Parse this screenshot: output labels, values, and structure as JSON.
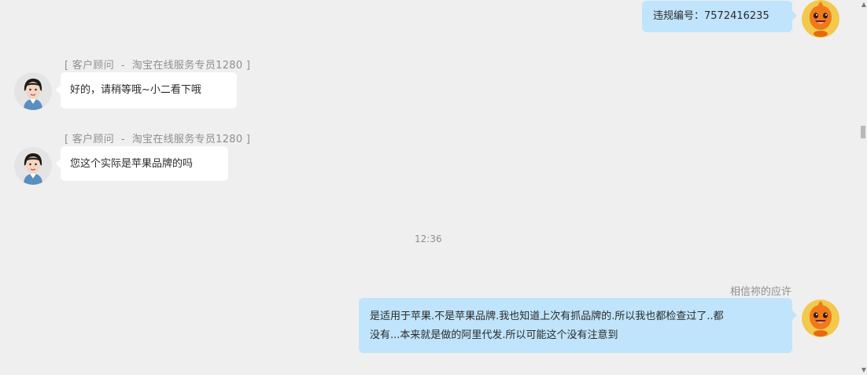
{
  "messages": {
    "m1": {
      "text": "违规编号：7572416235"
    },
    "m2": {
      "sender": "[ 客户顾问  -  淘宝在线服务专员1280 ]",
      "text": "好的，请稍等哦~小二看下哦"
    },
    "m3": {
      "sender": "[ 客户顾问  -  淘宝在线服务专员1280 ]",
      "text": "您这个实际是苹果品牌的吗"
    },
    "time": "12:36",
    "m4": {
      "sender": "相信祢的应许",
      "line1": "是适用于苹果.不是苹果品牌.我也知道上次有抓品牌的.所以我也都检查过了..都",
      "line2": "没有...本来就是做的阿里代发.所以可能这个没有注意到"
    }
  },
  "icons": {
    "agent_avatar": "agent-avatar-photo",
    "user_avatar": "orange-mascot-avatar"
  },
  "colors": {
    "background": "#efefef",
    "bubble_left": "#ffffff",
    "bubble_right": "#bfe4fb",
    "meta_text": "#8f8f8f"
  }
}
